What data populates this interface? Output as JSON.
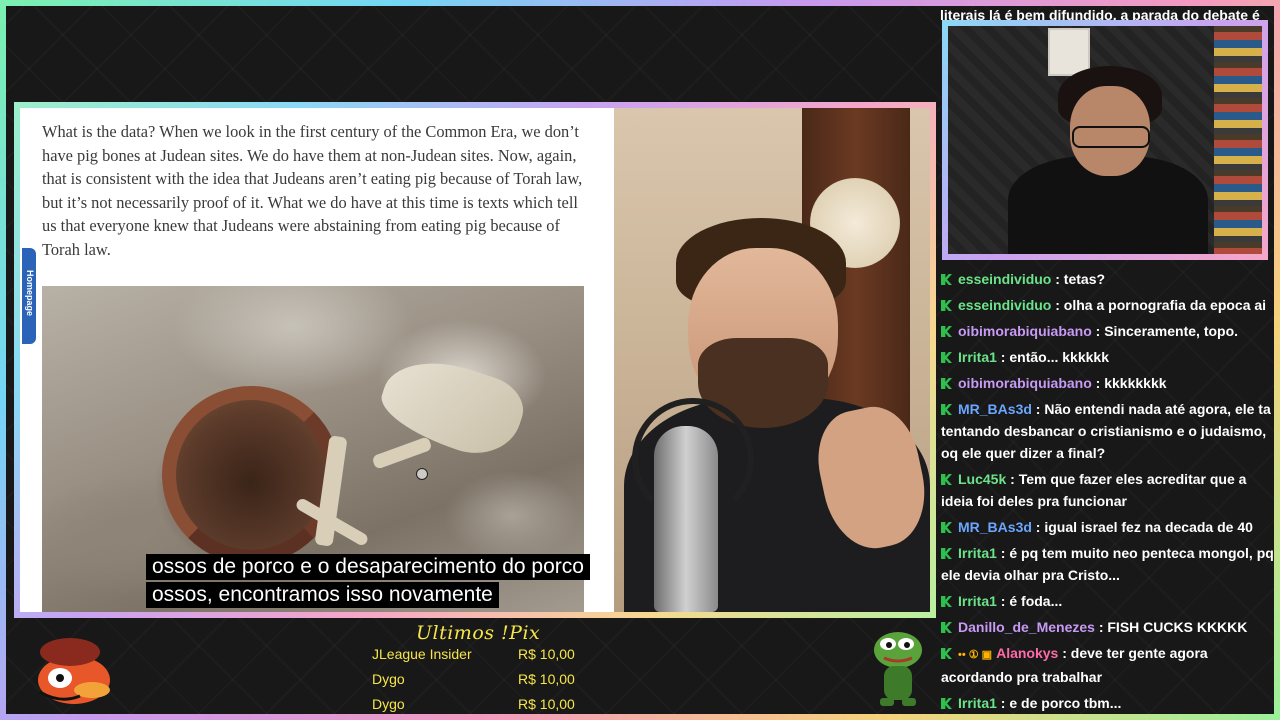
{
  "article": {
    "paragraph": "What is the data? When we look in the first century of the Common Era, we don’t have pig bones at Judean sites. We do have them at non-Judean sites. Now, again, that is consistent with the idea that Judeans aren’t eating pig because of Torah law, but it’s not necessarily proof of it. What we do have at this time is texts which tell us that everyone knew that Judeans were abstaining from eating pig because of Torah law.",
    "side_tab": "Homepage"
  },
  "subtitles": {
    "line1": "ossos de porco e o desaparecimento do porco",
    "line2": "ossos, encontramos isso novamente"
  },
  "chat": {
    "top_partial": "literais lá é bem difundido, a parada do debate é",
    "messages": [
      {
        "user": "esseindividuo",
        "text": " : tetas?",
        "color": "green"
      },
      {
        "user": "esseindividuo",
        "text": " : olha a pornografia da epoca ai",
        "color": "green"
      },
      {
        "user": "oibimorabiquiabano",
        "text": " : Sinceramente, topo.",
        "color": "purple"
      },
      {
        "user": "Irrita1",
        "text": " : então... kkkkkk",
        "color": "green"
      },
      {
        "user": "oibimorabiquiabano",
        "text": " : kkkkkkkk",
        "color": "purple"
      },
      {
        "user": "MR_BAs3d",
        "text": " : Não entendi nada até agora, ele ta tentando desbancar o cristianismo e o judaismo, oq ele quer dizer a final?",
        "color": "blue"
      },
      {
        "user": "Luc45k",
        "text": " : Tem que fazer eles acreditar que a ideia foi deles pra funcionar",
        "color": "green"
      },
      {
        "user": "MR_BAs3d",
        "text": " : igual israel fez na decada de 40",
        "color": "blue"
      },
      {
        "user": "Irrita1",
        "text": " : é pq tem muito neo penteca mongol, pq ele devia olhar pra Cristo...",
        "color": "green"
      },
      {
        "user": "Irrita1",
        "text": " : é foda...",
        "color": "green"
      },
      {
        "user": "Danillo_de_Menezes",
        "text": " : FISH CUCKS KKKKK",
        "color": "purple"
      },
      {
        "user": "Alanokys",
        "text": " : deve ter gente agora acordando pra trabalhar",
        "color": "pink",
        "extra_badges": "•• ① ▣"
      },
      {
        "user": "Irrita1",
        "text": " : e de porco tbm...",
        "color": "green"
      }
    ]
  },
  "pix": {
    "title": "Ultimos !Pix",
    "entries": [
      {
        "name": "JLeague Insider",
        "amount": "R$ 10,00"
      },
      {
        "name": "Dygo",
        "amount": "R$ 10,00"
      },
      {
        "name": "Dygo",
        "amount": "R$ 10,00"
      }
    ]
  },
  "colors": {
    "accent_yellow": "#f6e64a",
    "chat_badge_green": "#2fbf4f"
  },
  "icons": {
    "chat_badge": "kick-k-icon",
    "mascot": "cartoon-mascot-icon",
    "pepe": "pepe-frog-icon"
  }
}
